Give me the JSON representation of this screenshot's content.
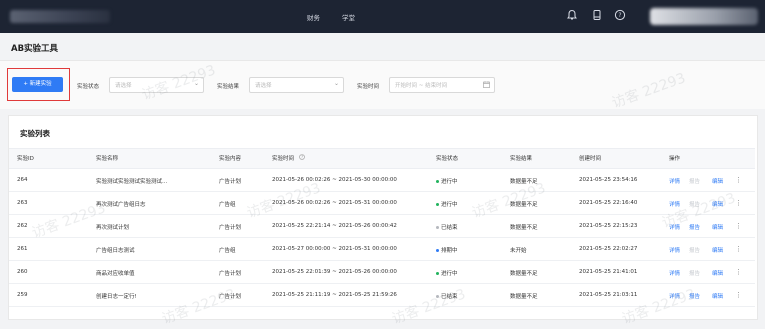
{
  "topnav": {
    "items": [
      "财务",
      "学堂"
    ],
    "icons": [
      "bell-icon",
      "mobile-icon",
      "help-icon"
    ]
  },
  "page": {
    "title": "AB实验工具"
  },
  "filters": {
    "new_button": "+ 新建实验",
    "status_label": "实验状态",
    "status_placeholder": "请选择",
    "result_label": "实验结果",
    "result_placeholder": "请选择",
    "time_label": "实验时间",
    "time_placeholder": "开始时间 ~ 结束时间"
  },
  "table": {
    "title": "实验列表",
    "headers": [
      "实验ID",
      "实验名称",
      "实验内容",
      "实验时间",
      "实验状态",
      "实验结果",
      "创建时间",
      "操作"
    ],
    "rows": [
      {
        "id": "264",
        "name": "实验测试实验测试实验测试...",
        "content": "广告计划",
        "time": "2021-05-26 00:02:26 ~ 2021-05-30 00:00:00",
        "status": "进行中",
        "status_color": "#22b35e",
        "result": "数据量不足",
        "created": "2021-05-25 23:54:16",
        "actions": [
          "详情",
          "报告",
          "编辑"
        ],
        "enabled": [
          true,
          false,
          true
        ]
      },
      {
        "id": "263",
        "name": "再次测试广告组日志",
        "content": "广告组",
        "time": "2021-05-26 00:02:26 ~ 2021-05-31 00:00:00",
        "status": "进行中",
        "status_color": "#22b35e",
        "result": "数据量不足",
        "created": "2021-05-25 22:16:40",
        "actions": [
          "详情",
          "报告",
          "编辑"
        ],
        "enabled": [
          true,
          false,
          true
        ]
      },
      {
        "id": "262",
        "name": "再次测试计划",
        "content": "广告计划",
        "time": "2021-05-25 22:21:14 ~ 2021-05-26 00:00:42",
        "status": "已结束",
        "status_color": "#b5b8be",
        "result": "数据量不足",
        "created": "2021-05-25 22:15:23",
        "actions": [
          "详情",
          "报告",
          "编辑"
        ],
        "enabled": [
          true,
          true,
          true
        ]
      },
      {
        "id": "261",
        "name": "广告组日志测试",
        "content": "广告组",
        "time": "2021-05-27 00:00:00 ~ 2021-05-31 00:00:00",
        "status": "排期中",
        "status_color": "#2f7bf5",
        "result": "未开始",
        "created": "2021-05-25 22:02:27",
        "actions": [
          "详情",
          "报告",
          "编辑"
        ],
        "enabled": [
          true,
          false,
          true
        ]
      },
      {
        "id": "260",
        "name": "商品对应收单值",
        "content": "广告计划",
        "time": "2021-05-25 22:01:39 ~ 2021-05-26 00:00:00",
        "status": "进行中",
        "status_color": "#22b35e",
        "result": "数据量不足",
        "created": "2021-05-25 21:41:01",
        "actions": [
          "详情",
          "报告",
          "编辑"
        ],
        "enabled": [
          true,
          false,
          true
        ]
      },
      {
        "id": "259",
        "name": "创建日志一定行!",
        "content": "广告计划",
        "time": "2021-05-25 21:11:19 ~ 2021-05-25 21:59:26",
        "status": "已结束",
        "status_color": "#b5b8be",
        "result": "数据量不足",
        "created": "2021-05-25 21:03:11",
        "actions": [
          "详情",
          "报告",
          "编辑"
        ],
        "enabled": [
          true,
          true,
          true
        ]
      }
    ]
  },
  "watermark": "访客 22293"
}
